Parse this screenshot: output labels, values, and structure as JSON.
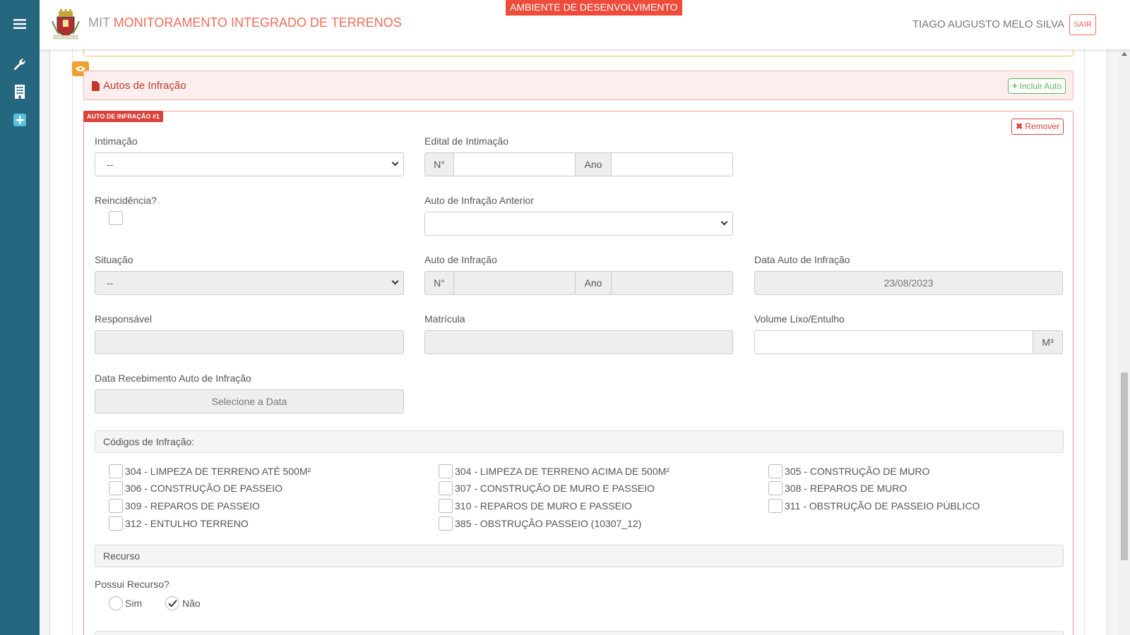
{
  "header": {
    "app_prefix": "MIT",
    "app_name": "MONITORAMENTO INTEGRADO DE TERRENOS",
    "env_badge": "AMBIENTE DE DESENVOLVIMENTO",
    "user_name": "TIAGO AUGUSTO MELO SILVA",
    "logout_label": "SAIR"
  },
  "sidebar": {
    "items": [
      {
        "icon": "menu-icon"
      },
      {
        "icon": "wrench-icon"
      },
      {
        "icon": "building-icon"
      },
      {
        "icon": "plus-square-icon"
      }
    ]
  },
  "section": {
    "title": "Autos de Infração",
    "add_label": "Incluir Auto"
  },
  "auto": {
    "tag": "AUTO DE INFRAÇÃO #1",
    "remove_label": "Remover",
    "intimacao": {
      "label": "Intimação",
      "value": "--"
    },
    "edital": {
      "label": "Edital de Intimação",
      "num_addon": "N°",
      "ano_addon": "Ano",
      "num_value": "",
      "ano_value": ""
    },
    "reincidencia": {
      "label": "Reincidência?",
      "checked": false
    },
    "auto_anterior": {
      "label": "Auto de Infração Anterior",
      "value": ""
    },
    "situacao": {
      "label": "Situação",
      "value": "--"
    },
    "auto_infracao": {
      "label": "Auto de Infração",
      "num_addon": "N°",
      "ano_addon": "Ano",
      "num_value": "",
      "ano_value": ""
    },
    "data_auto": {
      "label": "Data Auto de Infração",
      "value": "23/08/2023"
    },
    "responsavel": {
      "label": "Responsável",
      "value": ""
    },
    "matricula": {
      "label": "Matrícula",
      "value": ""
    },
    "volume": {
      "label": "Volume Lixo/Entulho",
      "value": "",
      "unit": "M³"
    },
    "data_recebimento": {
      "label": "Data Recebimento Auto de Infração",
      "placeholder": "Selecione a Data"
    },
    "codigos": {
      "title": "Códigos de Infração:",
      "items": [
        {
          "label": "304 - LIMPEZA DE TERRENO ATÉ 500M²",
          "checked": false
        },
        {
          "label": "304 - LIMPEZA DE TERRENO ACIMA DE 500M²",
          "checked": false
        },
        {
          "label": "305 - CONSTRUÇÃO DE MURO",
          "checked": false
        },
        {
          "label": "306 - CONSTRUÇÃO DE PASSEIO",
          "checked": false
        },
        {
          "label": "307 - CONSTRUÇÃO DE MURO E PASSEIO",
          "checked": false
        },
        {
          "label": "308 - REPAROS DE MURO",
          "checked": false
        },
        {
          "label": "309 - REPAROS DE PASSEIO",
          "checked": false
        },
        {
          "label": "310 - REPAROS DE MURO E PASSEIO",
          "checked": false
        },
        {
          "label": "311 - OBSTRUÇÃO DE PASSEIO PÚBLICO",
          "checked": false
        },
        {
          "label": "312 - ENTULHO TERRENO",
          "checked": false
        },
        {
          "label": "385 - OBSTRUÇÃO PASSEIO (10307_12)",
          "checked": false
        }
      ]
    },
    "recurso": {
      "title": "Recurso",
      "question": "Possui Recurso?",
      "options": [
        {
          "label": "Sim",
          "selected": false
        },
        {
          "label": "Não",
          "selected": true
        }
      ]
    }
  },
  "colors": {
    "sidebar": "#24677f",
    "accent": "#f06d5b",
    "danger": "#d9413a",
    "success": "#5cb85c",
    "warning": "#f0a030"
  }
}
